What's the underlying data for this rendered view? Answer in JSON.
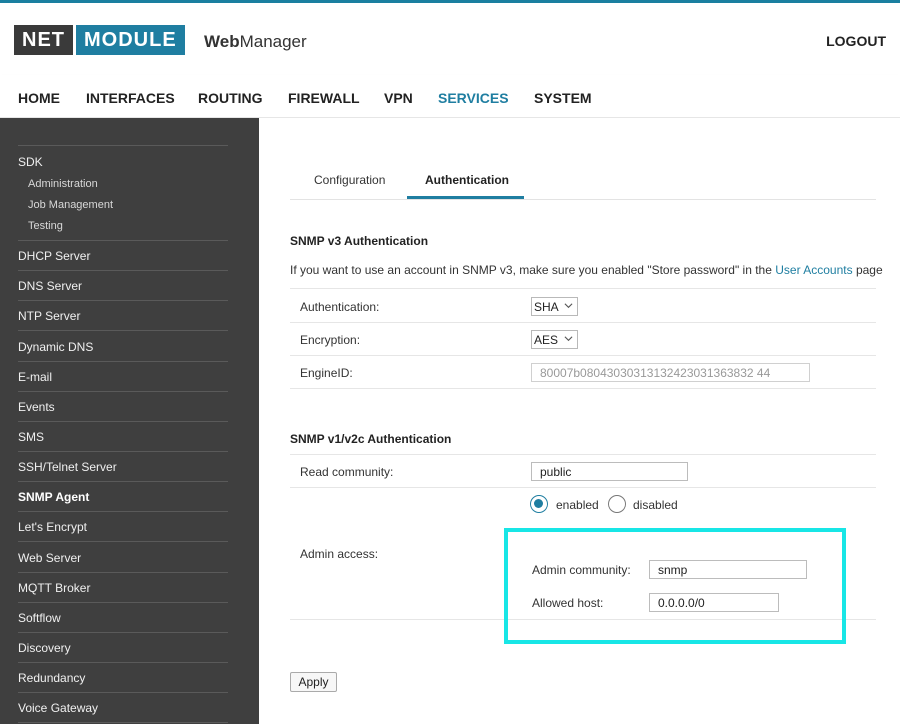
{
  "header": {
    "logo_left": "NET",
    "logo_right": "MODULE",
    "app_name_bold": "Web",
    "app_name_rest": "Manager",
    "logout_label": "LOGOUT"
  },
  "nav": {
    "items": [
      "HOME",
      "INTERFACES",
      "ROUTING",
      "FIREWALL",
      "VPN",
      "SERVICES",
      "SYSTEM"
    ],
    "active": "SERVICES"
  },
  "sidebar": {
    "sdk_label": "SDK",
    "sdk_sub": [
      "Administration",
      "Job Management",
      "Testing"
    ],
    "items": [
      "DHCP Server",
      "DNS Server",
      "NTP Server",
      "Dynamic DNS",
      "E-mail",
      "Events",
      "SMS",
      "SSH/Telnet Server",
      "SNMP Agent",
      "Let's Encrypt",
      "Web Server",
      "MQTT Broker",
      "Softflow",
      "Discovery",
      "Redundancy",
      "Voice Gateway"
    ],
    "active": "SNMP Agent"
  },
  "tabs": {
    "configuration": "Configuration",
    "authentication": "Authentication",
    "active": "Authentication"
  },
  "snmp_v3": {
    "title": "SNMP v3 Authentication",
    "info_prefix": "If you want to use an account in SNMP v3, make sure you enabled \"Store password\" in the ",
    "info_link": "User Accounts",
    "info_suffix": " page",
    "authentication_label": "Authentication:",
    "authentication_value": "SHA",
    "encryption_label": "Encryption:",
    "encryption_value": "AES",
    "engineid_label": "EngineID:",
    "engineid_value": "80007b08043030313132423031363832 44"
  },
  "snmp_v1v2c": {
    "title": "SNMP v1/v2c Authentication",
    "read_community_label": "Read community:",
    "read_community_value": "public",
    "admin_access_label": "Admin access:",
    "enabled_label": "enabled",
    "disabled_label": "disabled",
    "admin_access_state": "enabled",
    "admin_community_label": "Admin community:",
    "admin_community_value": "snmp",
    "allowed_host_label": "Allowed host:",
    "allowed_host_value": "0.0.0.0/0"
  },
  "apply_label": "Apply",
  "colors": {
    "accent": "#1f7ea1",
    "sidebar_bg": "#3f3f3f",
    "highlight": "#18e6e6"
  }
}
